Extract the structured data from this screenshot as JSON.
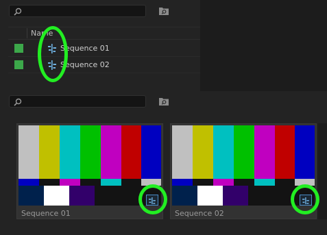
{
  "top_panel": {
    "search": {
      "placeholder": "",
      "value": ""
    },
    "new_bin_icon": "folder-search-icon",
    "columns": {
      "name_label": "Name"
    },
    "rows": [
      {
        "name": "Sequence 01",
        "label_color": "#3ca84a",
        "icon": "sequence-icon"
      },
      {
        "name": "Sequence 02",
        "label_color": "#3ca84a",
        "icon": "sequence-icon"
      }
    ]
  },
  "bottom_panel": {
    "search": {
      "placeholder": "",
      "value": ""
    },
    "new_bin_icon": "folder-search-icon",
    "thumbnails": [
      {
        "caption": "Sequence 01",
        "badge_icon": "sequence-icon"
      },
      {
        "caption": "Sequence 02",
        "badge_icon": "sequence-icon"
      }
    ]
  },
  "colors": {
    "highlight": "#22ee22",
    "label_green": "#3ca84a",
    "panel_bg": "#232323",
    "badge_border": "#4a8cc8"
  }
}
